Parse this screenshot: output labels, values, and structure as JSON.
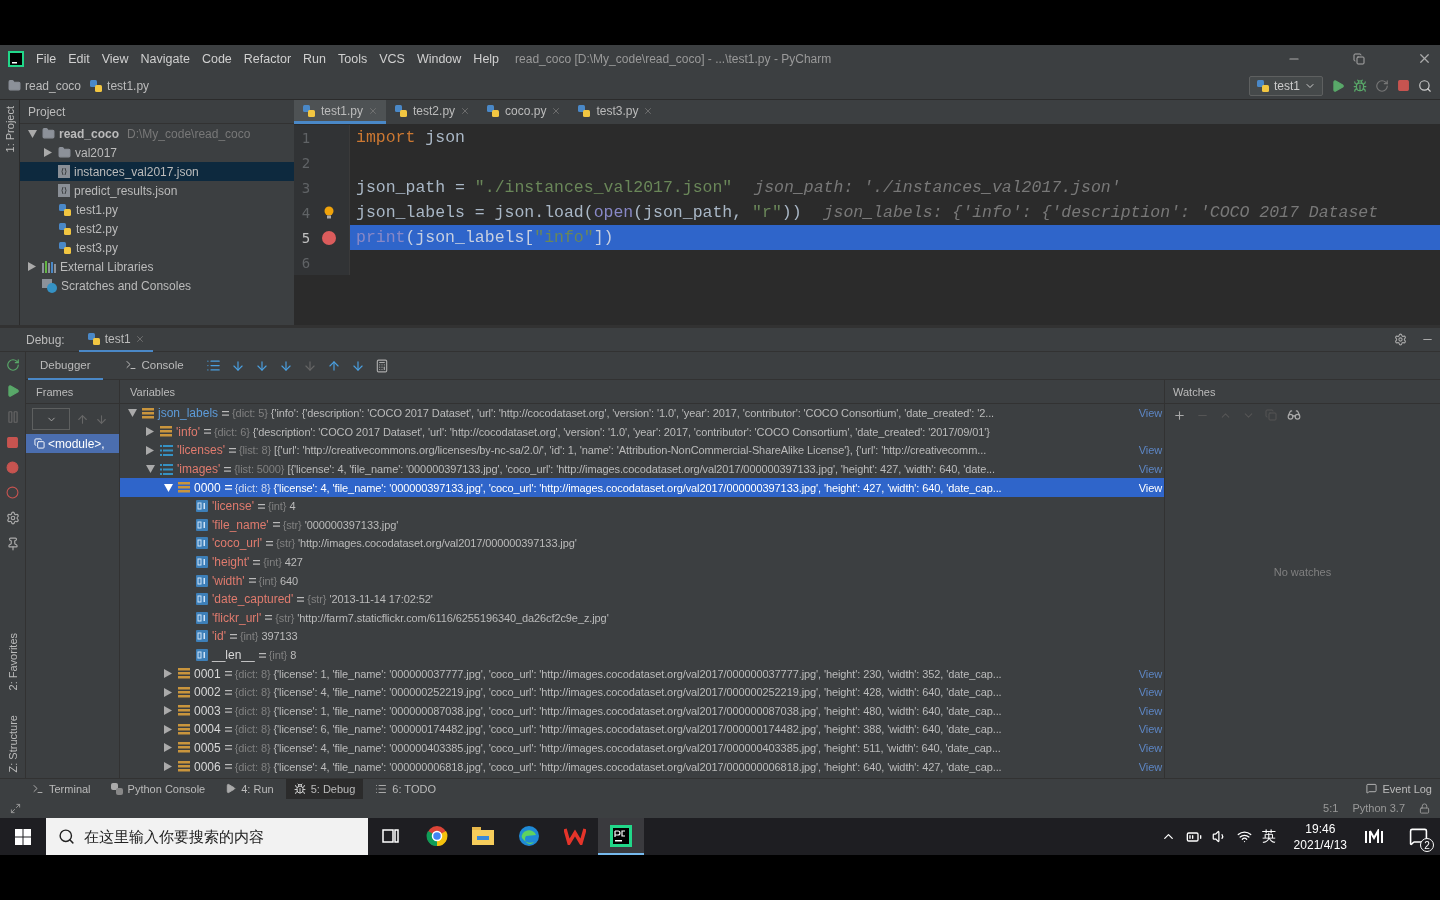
{
  "menu_bar": {
    "items": [
      "File",
      "Edit",
      "View",
      "Navigate",
      "Code",
      "Refactor",
      "Run",
      "Tools",
      "VCS",
      "Window",
      "Help"
    ],
    "title": "read_coco [D:\\My_code\\read_coco] - ...\\test1.py - PyCharm"
  },
  "nav_bar": {
    "breadcrumbs": [
      "read_coco",
      "test1.py"
    ],
    "run_config": "test1"
  },
  "side_strip": {
    "top": "1: Project",
    "middle": "2: Favorites",
    "bottom": "Z: Structure"
  },
  "project_panel": {
    "title": "Project",
    "tree": [
      {
        "label": "read_coco",
        "path": "D:\\My_code\\read_coco",
        "kind": "folder",
        "expanded": true,
        "selected": false,
        "children": [
          {
            "label": "val2017",
            "kind": "folder",
            "expanded": false,
            "selected": false
          },
          {
            "label": "instances_val2017.json",
            "kind": "json",
            "selected": true
          },
          {
            "label": "predict_results.json",
            "kind": "json",
            "selected": false
          },
          {
            "label": "test1.py",
            "kind": "python",
            "selected": false
          },
          {
            "label": "test2.py",
            "kind": "python",
            "selected": false
          },
          {
            "label": "test3.py",
            "kind": "python",
            "selected": false
          }
        ]
      },
      {
        "label": "External Libraries",
        "kind": "library",
        "expanded": false,
        "selected": false
      },
      {
        "label": "Scratches and Consoles",
        "kind": "scratch",
        "selected": false
      }
    ]
  },
  "editor": {
    "tabs": [
      {
        "label": "test1.py",
        "selected": true
      },
      {
        "label": "test2.py",
        "selected": false
      },
      {
        "label": "coco.py",
        "selected": false
      },
      {
        "label": "test3.py",
        "selected": false
      }
    ],
    "lines": [
      {
        "number": "1",
        "breakpoint": false,
        "current": false,
        "bulb": false,
        "tokens": [
          {
            "kind": "keyword",
            "text": "import"
          },
          {
            "kind": "plain",
            "text": " json"
          }
        ]
      },
      {
        "number": "2",
        "breakpoint": false,
        "current": false,
        "bulb": false
      },
      {
        "number": "3",
        "breakpoint": false,
        "current": false,
        "bulb": false,
        "tokens": [
          {
            "kind": "plain",
            "text": "json_path = "
          },
          {
            "kind": "string",
            "text": "\"./instances_val2017.json\""
          },
          {
            "kind": "hint",
            "text": "json_path: './instances_val2017.json'"
          }
        ]
      },
      {
        "number": "4",
        "breakpoint": false,
        "current": false,
        "bulb": true,
        "tokens": [
          {
            "kind": "plain",
            "text": "json_labels = json.load("
          },
          {
            "kind": "builtin",
            "text": "open"
          },
          {
            "kind": "plain",
            "text": "(json_path, "
          },
          {
            "kind": "string",
            "text": "\"r\""
          },
          {
            "kind": "plain",
            "text": "))"
          },
          {
            "kind": "hint",
            "text": "json_labels: {'info': {'description': 'COCO 2017 Dataset"
          }
        ]
      },
      {
        "number": "5",
        "breakpoint": true,
        "current": true,
        "bulb": false,
        "tokens": [
          {
            "kind": "builtin",
            "text": "print"
          },
          {
            "kind": "plain",
            "text": "(json_labels["
          },
          {
            "kind": "string",
            "text": "\"info\""
          },
          {
            "kind": "plain",
            "text": "])"
          }
        ]
      },
      {
        "number": "6",
        "breakpoint": false,
        "current": false,
        "bulb": false
      }
    ]
  },
  "debug": {
    "title": "Debug:",
    "session": "test1",
    "tabs": [
      {
        "label": "Debugger",
        "selected": true
      },
      {
        "label": "Console",
        "selected": false
      }
    ],
    "frames_title": "Frames",
    "frames": [
      {
        "label": "<module>,",
        "selected": true
      }
    ],
    "variables_title": "Variables",
    "variables": [
      {
        "name": "json_labels",
        "color": "#5d9bd8",
        "type": "{dict: 5}",
        "value": "{'info': {'description': 'COCO 2017 Dataset', 'url': 'http://cocodataset.org', 'version': '1.0', 'year': 2017, 'contributor': 'COCO Consortium', 'date_created': '2...",
        "view": "View",
        "kind": "dict",
        "expanded": true,
        "selected": false,
        "children": [
          {
            "name": "'info'",
            "color": "#e07b6e",
            "type": "{dict: 6}",
            "value": "{'description': 'COCO 2017 Dataset', 'url': 'http://cocodataset.org', 'version': '1.0', 'year': 2017, 'contributor': 'COCO Consortium', 'date_created': '2017/09/01'}",
            "kind": "dict",
            "expanded": false,
            "selected": false
          },
          {
            "name": "'licenses'",
            "color": "#e07b6e",
            "type": "{list: 8}",
            "value": "[{'url': 'http://creativecommons.org/licenses/by-nc-sa/2.0/', 'id': 1, 'name': 'Attribution-NonCommercial-ShareAlike License'}, {'url': 'http://creativecomm...",
            "view": "View",
            "kind": "list",
            "expanded": false,
            "selected": false
          },
          {
            "name": "'images'",
            "color": "#e07b6e",
            "type": "{list: 5000}",
            "value": "[{'license': 4, 'file_name': '000000397133.jpg', 'coco_url': 'http://images.cocodataset.org/val2017/000000397133.jpg', 'height': 427, 'width': 640, 'date...",
            "view": "View",
            "kind": "list",
            "expanded": true,
            "selected": false,
            "children": [
              {
                "name": "0000",
                "color": "#ffffff",
                "type": "{dict: 8}",
                "value": "{'license': 4, 'file_name': '000000397133.jpg', 'coco_url': 'http://images.cocodataset.org/val2017/000000397133.jpg', 'height': 427, 'width': 640, 'date_cap...",
                "view": "View",
                "kind": "dict",
                "expanded": true,
                "selected": true,
                "children": [
                  {
                    "name": "'license'",
                    "color": "#e07b6e",
                    "type": "{int}",
                    "value": "4",
                    "kind": "leaf",
                    "selected": false
                  },
                  {
                    "name": "'file_name'",
                    "color": "#e07b6e",
                    "type": "{str}",
                    "value": "'000000397133.jpg'",
                    "kind": "leaf",
                    "selected": false
                  },
                  {
                    "name": "'coco_url'",
                    "color": "#e07b6e",
                    "type": "{str}",
                    "value": "'http://images.cocodataset.org/val2017/000000397133.jpg'",
                    "kind": "leaf",
                    "selected": false
                  },
                  {
                    "name": "'height'",
                    "color": "#e07b6e",
                    "type": "{int}",
                    "value": "427",
                    "kind": "leaf",
                    "selected": false
                  },
                  {
                    "name": "'width'",
                    "color": "#e07b6e",
                    "type": "{int}",
                    "value": "640",
                    "kind": "leaf",
                    "selected": false
                  },
                  {
                    "name": "'date_captured'",
                    "color": "#e07b6e",
                    "type": "{str}",
                    "value": "'2013-11-14 17:02:52'",
                    "kind": "leaf",
                    "selected": false
                  },
                  {
                    "name": "'flickr_url'",
                    "color": "#e07b6e",
                    "type": "{str}",
                    "value": "'http://farm7.staticflickr.com/6116/6255196340_da26cf2c9e_z.jpg'",
                    "kind": "leaf",
                    "selected": false
                  },
                  {
                    "name": "'id'",
                    "color": "#e07b6e",
                    "type": "{int}",
                    "value": "397133",
                    "kind": "leaf",
                    "selected": false
                  },
                  {
                    "name": "__len__",
                    "color": "#d8d8d8",
                    "type": "{int}",
                    "value": "8",
                    "kind": "leaf",
                    "selected": false
                  }
                ]
              },
              {
                "name": "0001",
                "color": "#d8d8d8",
                "type": "{dict: 8}",
                "value": "{'license': 1, 'file_name': '000000037777.jpg', 'coco_url': 'http://images.cocodataset.org/val2017/000000037777.jpg', 'height': 230, 'width': 352, 'date_cap...",
                "view": "View",
                "kind": "dict",
                "expanded": false,
                "selected": false
              },
              {
                "name": "0002",
                "color": "#d8d8d8",
                "type": "{dict: 8}",
                "value": "{'license': 4, 'file_name': '000000252219.jpg', 'coco_url': 'http://images.cocodataset.org/val2017/000000252219.jpg', 'height': 428, 'width': 640, 'date_cap...",
                "view": "View",
                "kind": "dict",
                "expanded": false,
                "selected": false
              },
              {
                "name": "0003",
                "color": "#d8d8d8",
                "type": "{dict: 8}",
                "value": "{'license': 1, 'file_name': '000000087038.jpg', 'coco_url': 'http://images.cocodataset.org/val2017/000000087038.jpg', 'height': 480, 'width': 640, 'date_cap...",
                "view": "View",
                "kind": "dict",
                "expanded": false,
                "selected": false
              },
              {
                "name": "0004",
                "color": "#d8d8d8",
                "type": "{dict: 8}",
                "value": "{'license': 6, 'file_name': '000000174482.jpg', 'coco_url': 'http://images.cocodataset.org/val2017/000000174482.jpg', 'height': 388, 'width': 640, 'date_cap...",
                "view": "View",
                "kind": "dict",
                "expanded": false,
                "selected": false
              },
              {
                "name": "0005",
                "color": "#d8d8d8",
                "type": "{dict: 8}",
                "value": "{'license': 4, 'file_name': '000000403385.jpg', 'coco_url': 'http://images.cocodataset.org/val2017/000000403385.jpg', 'height': 511, 'width': 640, 'date_cap...",
                "view": "View",
                "kind": "dict",
                "expanded": false,
                "selected": false
              },
              {
                "name": "0006",
                "color": "#d8d8d8",
                "type": "{dict: 8}",
                "value": "{'license': 4, 'file_name': '000000006818.jpg', 'coco_url': 'http://images.cocodataset.org/val2017/000000006818.jpg', 'height': 640, 'width': 427, 'date_cap...",
                "view": "View",
                "kind": "dict",
                "expanded": false,
                "selected": false
              }
            ]
          }
        ]
      }
    ],
    "watches_title": "Watches",
    "watches_empty": "No watches"
  },
  "tool_tabs": [
    {
      "label": "Terminal",
      "kind": "terminal",
      "selected": false
    },
    {
      "label": "Python Console",
      "kind": "python",
      "selected": false
    },
    {
      "label": "4: Run",
      "kind": "run",
      "selected": false
    },
    {
      "label": "5: Debug",
      "kind": "debug",
      "selected": true
    },
    {
      "label": "6: TODO",
      "kind": "todo",
      "selected": false
    }
  ],
  "event_log": "Event Log",
  "status_bar": {
    "position": "5:1",
    "interpreter": "Python 3.7"
  },
  "taskbar": {
    "search_placeholder": "在这里输入你要搜索的内容",
    "apps": [
      {
        "kind": "chrome",
        "active": false
      },
      {
        "kind": "folder",
        "active": false
      },
      {
        "kind": "edge",
        "active": false
      },
      {
        "kind": "wps",
        "active": false
      },
      {
        "kind": "pycharm",
        "active": true
      }
    ],
    "ime": "英",
    "time": "19:46",
    "date": "2021/4/13",
    "notifications": "2"
  }
}
